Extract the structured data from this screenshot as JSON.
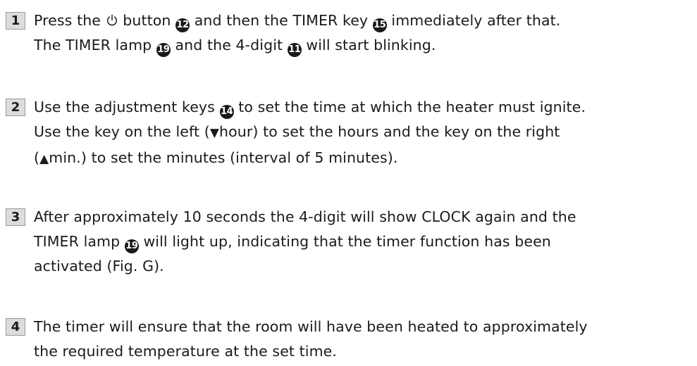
{
  "steps": [
    {
      "number": "1",
      "lines": [
        [
          "Press the ",
          {
            "icon": "power-icon"
          },
          " button ",
          {
            "circled": "12"
          },
          " and then the TIMER key ",
          {
            "circled": "15"
          },
          " immediately after that."
        ],
        [
          "The TIMER lamp ",
          {
            "circled": "19"
          },
          " and the 4-digit ",
          {
            "circled": "11"
          },
          " will start blinking."
        ]
      ]
    },
    {
      "number": "2",
      "lines": [
        [
          "Use the adjustment keys ",
          {
            "circled": "14"
          },
          " to set the time at which the heater must ignite."
        ],
        [
          "Use the key on the left (",
          {
            "glyph": "▼"
          },
          "hour) to set the hours and the key on the right"
        ],
        [
          "(",
          {
            "glyph": "▲"
          },
          "min.) to set the minutes (interval of 5 minutes)."
        ]
      ]
    },
    {
      "number": "3",
      "lines": [
        [
          "After approximately 10 seconds the 4-digit will show CLOCK again and the"
        ],
        [
          "TIMER lamp ",
          {
            "circled": "19"
          },
          " will light up, indicating that the timer function has been"
        ],
        [
          "activated (Fig. G)."
        ]
      ]
    },
    {
      "number": "4",
      "lines": [
        [
          "The timer will ensure that the room will have been heated to approximately"
        ],
        [
          "the required temperature at the set time."
        ]
      ]
    }
  ]
}
